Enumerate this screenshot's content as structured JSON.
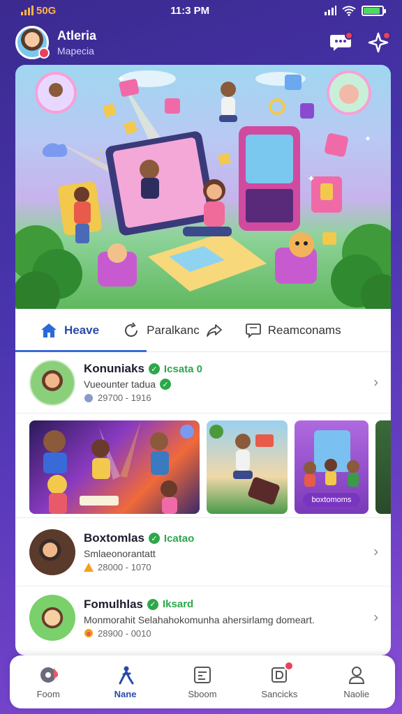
{
  "status_bar": {
    "carrier": "50G",
    "time": "11:3 PM",
    "battery_level": 0.9
  },
  "header": {
    "user_name": "Atleria",
    "user_sub": "Mapecia",
    "actions": [
      {
        "icon": "chat-icon",
        "badge": true
      },
      {
        "icon": "star-icon",
        "badge": true
      }
    ]
  },
  "tabs": [
    {
      "label": "Heave",
      "icon": "home-icon",
      "active": true
    },
    {
      "label": "Paralkanc",
      "icon": "refresh-icon",
      "active": false
    },
    {
      "label": "Reamconams",
      "icon": "chat-bubble-icon",
      "active": false
    }
  ],
  "rows": [
    {
      "title": "Konuniaks",
      "tag": "Icsata 0",
      "subtitle": "Vueounter tadua",
      "meta": "29700 - 1916"
    },
    {
      "title": "Boxtomlas",
      "tag": "Icatao",
      "subtitle": "Smlaeonorantatt",
      "meta": "28000 - 1070"
    },
    {
      "title": "Fomulhlas",
      "tag": "Iksard",
      "subtitle": "Monmorahit Selahahokomunha ahersirlamg domeart.",
      "meta": "28900 - 0010"
    }
  ],
  "thumbnails": [
    {
      "caption": ""
    },
    {
      "caption": ""
    },
    {
      "caption": "boxtomoms"
    }
  ],
  "bottom_nav": [
    {
      "label": "Foom",
      "icon": "gear-icon",
      "active": false
    },
    {
      "label": "Nane",
      "icon": "person-jump-icon",
      "active": true
    },
    {
      "label": "Sboom",
      "icon": "calendar-icon",
      "active": false
    },
    {
      "label": "Sancicks",
      "icon": "document-icon",
      "active": false,
      "badge": true
    },
    {
      "label": "Naolie",
      "icon": "profile-icon",
      "active": false
    }
  ],
  "colors": {
    "accent": "#2a4aa8",
    "verified": "#2ca84a",
    "badge": "#e8415a",
    "background": "#4a35b0"
  }
}
